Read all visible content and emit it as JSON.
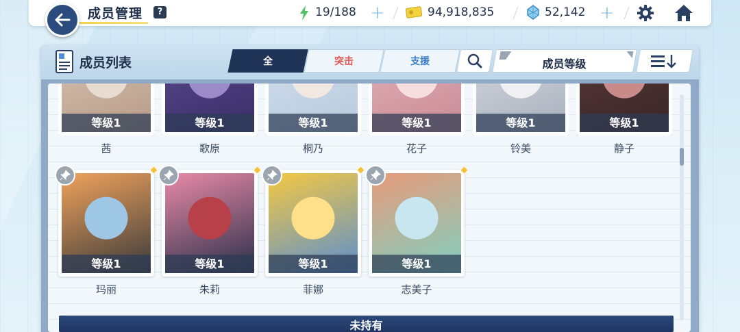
{
  "header": {
    "title": "成员管理",
    "help": "?",
    "stamina": "19/188",
    "credits": "94,918,835",
    "gems": "52,142"
  },
  "panel": {
    "title": "成员列表",
    "tabs": [
      "全",
      "突击",
      "支援"
    ],
    "sort_label": "成员等级"
  },
  "members_row1": [
    {
      "name": "茜",
      "level": "等级1"
    },
    {
      "name": "歌原",
      "level": "等级1"
    },
    {
      "name": "桐乃",
      "level": "等级1"
    },
    {
      "name": "花子",
      "level": "等级1"
    },
    {
      "name": "铃美",
      "level": "等级1"
    },
    {
      "name": "静子",
      "level": "等级1"
    }
  ],
  "members_row2": [
    {
      "name": "玛丽",
      "level": "等级1"
    },
    {
      "name": "朱莉",
      "level": "等级1"
    },
    {
      "name": "菲娜",
      "level": "等级1"
    },
    {
      "name": "志美子",
      "level": "等级1"
    }
  ],
  "bottom_label": "未持有",
  "colors": {
    "accent_dark": "#1f3457",
    "tab_red": "#e05454",
    "tab_blue": "#3b7ec9",
    "new_marker": "#f4c23a"
  }
}
